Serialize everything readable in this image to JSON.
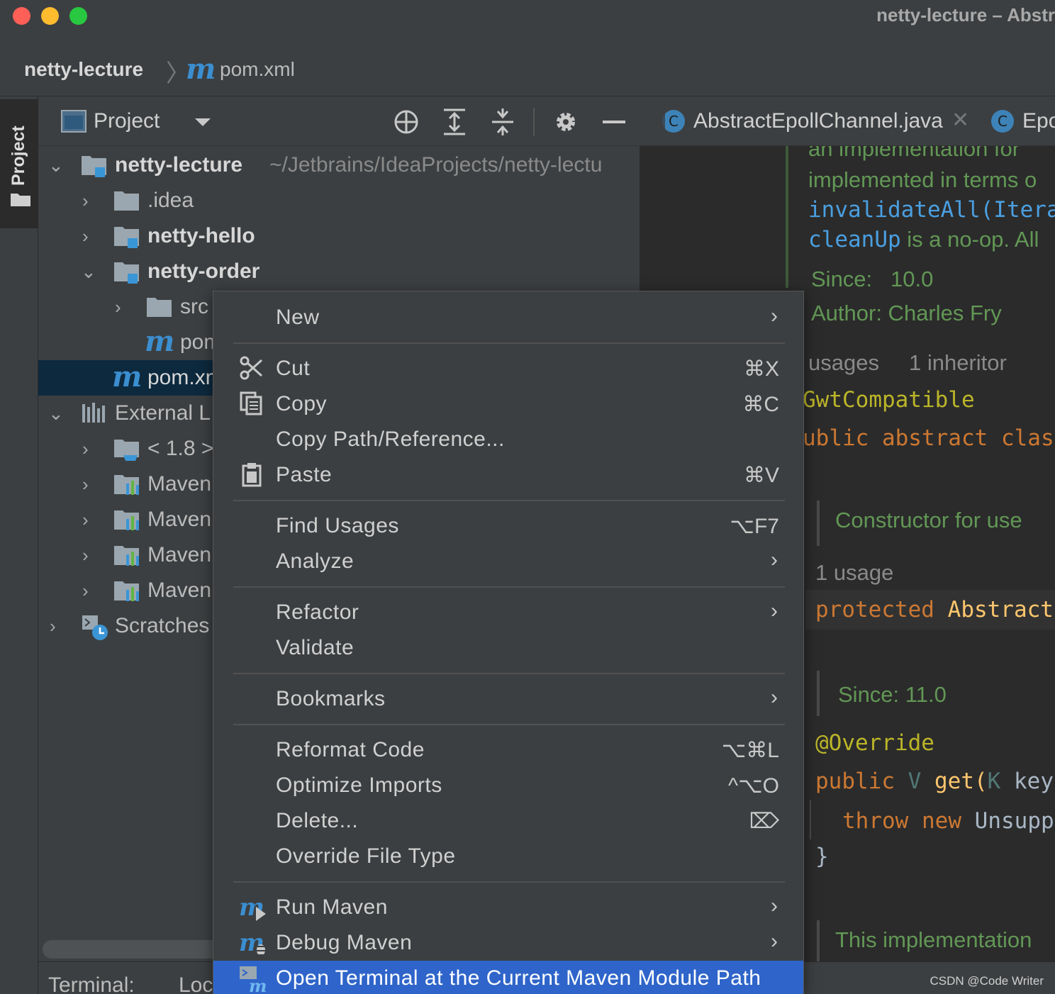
{
  "window": {
    "title": "netty-lecture – Abstr"
  },
  "breadcrumb": {
    "project": "netty-lecture",
    "file": "pom.xml"
  },
  "tool_stripe": {
    "project_label": "Project"
  },
  "project_panel": {
    "view_label": "Project",
    "tree": [
      {
        "label": "netty-lecture",
        "path": "~/Jetbrains/IdeaProjects/netty-lectu"
      },
      {
        "label": ".idea"
      },
      {
        "label": "netty-hello"
      },
      {
        "label": "netty-order"
      },
      {
        "label": "src"
      },
      {
        "label": "pom"
      },
      {
        "label": "pom.xml"
      },
      {
        "label": "External L"
      },
      {
        "label": "< 1.8 >"
      },
      {
        "label": "Maven"
      },
      {
        "label": "Maven"
      },
      {
        "label": "Maven"
      },
      {
        "label": "Maven"
      },
      {
        "label": "Scratches"
      }
    ]
  },
  "editor_tabs": [
    {
      "label": "AbstractEpollChannel.java"
    },
    {
      "label": "Epo"
    }
  ],
  "editor": {
    "doc1": [
      "an implementation for",
      "implemented in terms o",
      "invalidateAll(Iterab",
      "cleanUp is a no-op. All"
    ],
    "since1_label": "Since:",
    "since1_value": "10.0",
    "author": "Author: Charles Fry",
    "usages": "usages",
    "inheritor": "1 inheritor",
    "annotation1": "GwtCompatible",
    "decl_kw": "ublic abstract clas",
    "doc2": "Constructor for use",
    "usage2": "1 usage",
    "ctor_kw": "protected",
    "ctor_name": "Abstract",
    "since2": "Since: 11.0",
    "annotation2": "@Override",
    "method_kw": "public",
    "method_type": "V",
    "method_name": "get(",
    "method_param_type": "K",
    "method_param": "key",
    "throw_kw": "throw",
    "new_kw": "new",
    "throw_cls": "Unsupp",
    "close_brace": "}",
    "doc3": "This implementation"
  },
  "bottom_bar": {
    "terminal_label": "Terminal:",
    "tab": "Loc"
  },
  "context_menu": {
    "items": [
      {
        "label": "New",
        "submenu": true
      },
      {
        "label": "Cut",
        "shortcut": "⌘X",
        "icon": "scissors-icon"
      },
      {
        "label": "Copy",
        "shortcut": "⌘C",
        "icon": "copy-icon"
      },
      {
        "label": "Copy Path/Reference..."
      },
      {
        "label": "Paste",
        "shortcut": "⌘V",
        "icon": "clipboard-icon"
      },
      {
        "label": "Find Usages",
        "shortcut": "⌥F7"
      },
      {
        "label": "Analyze",
        "submenu": true
      },
      {
        "label": "Refactor",
        "submenu": true
      },
      {
        "label": "Validate"
      },
      {
        "label": "Bookmarks",
        "submenu": true
      },
      {
        "label": "Reformat Code",
        "shortcut": "⌥⌘L"
      },
      {
        "label": "Optimize Imports",
        "shortcut": "^⌥O"
      },
      {
        "label": "Delete...",
        "shortcut": "⌦"
      },
      {
        "label": "Override File Type"
      },
      {
        "label": "Run Maven",
        "submenu": true,
        "icon": "maven-run-icon"
      },
      {
        "label": "Debug Maven",
        "submenu": true,
        "icon": "maven-debug-icon"
      },
      {
        "label": "Open Terminal at the Current Maven Module Path",
        "icon": "maven-terminal-icon",
        "highlighted": true
      }
    ]
  },
  "watermark": "CSDN @Code Writer",
  "colors": {
    "accent": "#2f65ca",
    "selection": "#0d293e",
    "doc_green": "#629755",
    "keyword_orange": "#cc7832",
    "annotation_yellow": "#bbb529",
    "link_blue": "#4a9fe0",
    "folder_blue": "#3a95d6"
  }
}
